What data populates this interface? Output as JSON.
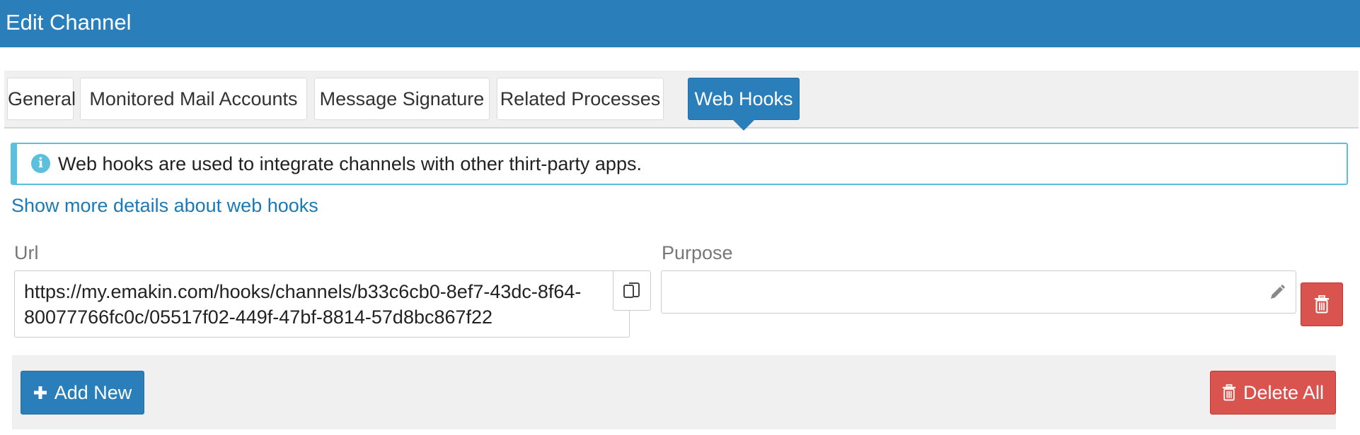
{
  "window": {
    "title": "Edit Channel"
  },
  "tabs": [
    {
      "label": "General",
      "active": false
    },
    {
      "label": "Monitored Mail Accounts",
      "active": false
    },
    {
      "label": "Message Signature",
      "active": false
    },
    {
      "label": "Related Processes",
      "active": false
    },
    {
      "label": "Web Hooks",
      "active": true
    }
  ],
  "info_alert": {
    "icon": "info-icon",
    "text": "Web hooks are used to integrate channels with other thirt-party apps."
  },
  "details_link": "Show more details about web hooks",
  "webhook_row": {
    "url_label": "Url",
    "url_value": "https://my.emakin.com/hooks/channels/b33c6cb0-8ef7-43dc-8f64-80077766fc0c/05517f02-449f-47bf-8814-57d8bc867f22",
    "purpose_label": "Purpose",
    "purpose_value": "",
    "copy_icon": "copy-icon",
    "edit_icon": "pencil-icon",
    "delete_icon": "trash-icon"
  },
  "footer": {
    "add_label": "Add New",
    "add_icon": "plus-icon",
    "delete_all_label": "Delete All",
    "delete_all_icon": "trash-icon"
  },
  "colors": {
    "primary": "#2a7fba",
    "danger": "#d9534f",
    "info": "#5bc0de",
    "link": "#1a7ab8"
  }
}
